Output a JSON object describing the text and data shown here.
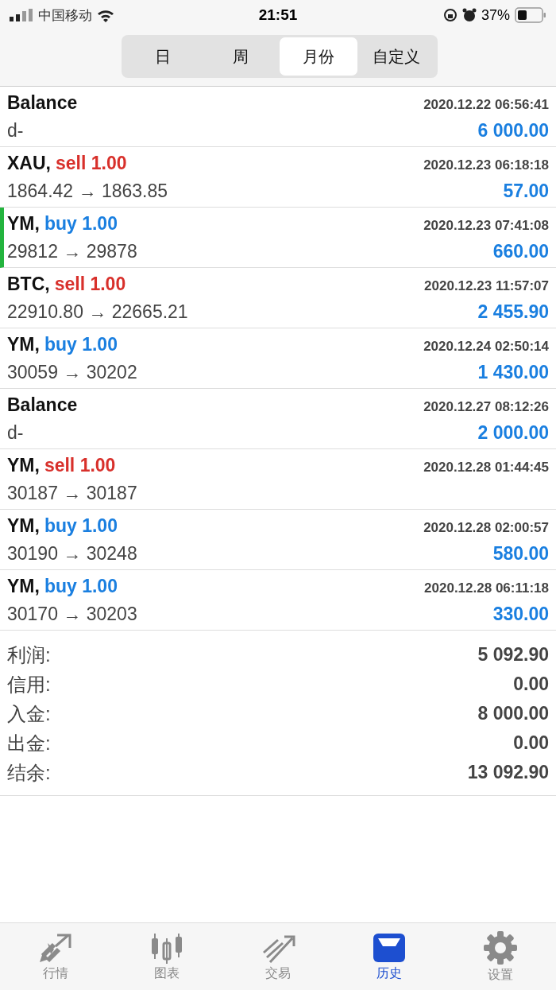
{
  "status_bar": {
    "carrier": "中国移动",
    "time": "21:51",
    "battery": "37%"
  },
  "periods": [
    {
      "label": "日",
      "selected": false
    },
    {
      "label": "周",
      "selected": false
    },
    {
      "label": "月份",
      "selected": true
    },
    {
      "label": "自定义",
      "selected": false
    }
  ],
  "deals": [
    {
      "kind": "balance",
      "title": "Balance",
      "time": "2020.12.22 06:56:41",
      "detail": "d-",
      "profit": "6 000.00",
      "marked": false
    },
    {
      "kind": "sell",
      "title": "XAU,",
      "volume": "sell 1.00",
      "time": "2020.12.23 06:18:18",
      "detail": "1864.42 → 1863.85",
      "profit": "57.00",
      "marked": false
    },
    {
      "kind": "buy",
      "title": "YM,",
      "volume": "buy 1.00",
      "time": "2020.12.23 07:41:08",
      "detail": "29812 → 29878",
      "profit": "660.00",
      "marked": true
    },
    {
      "kind": "sell",
      "title": "BTC,",
      "volume": "sell 1.00",
      "time": "2020.12.23 11:57:07",
      "detail": "22910.80 → 22665.21",
      "profit": "2 455.90",
      "marked": false
    },
    {
      "kind": "buy",
      "title": "YM,",
      "volume": "buy 1.00",
      "time": "2020.12.24 02:50:14",
      "detail": "30059 → 30202",
      "profit": "1 430.00",
      "marked": false
    },
    {
      "kind": "balance",
      "title": "Balance",
      "time": "2020.12.27 08:12:26",
      "detail": "d-",
      "profit": "2 000.00",
      "marked": false
    },
    {
      "kind": "sell",
      "title": "YM,",
      "volume": "sell 1.00",
      "time": "2020.12.28 01:44:45",
      "detail": "30187 → 30187",
      "marked": false
    },
    {
      "kind": "buy",
      "title": "YM,",
      "volume": "buy 1.00",
      "time": "2020.12.28 02:00:57",
      "detail": "30190 → 30248",
      "profit": "580.00",
      "marked": false
    },
    {
      "kind": "buy",
      "title": "YM,",
      "volume": "buy 1.00",
      "time": "2020.12.28 06:11:18",
      "detail": "30170 → 30203",
      "profit": "330.00",
      "marked": false
    }
  ],
  "summary": [
    {
      "label": "利润:",
      "value": "5 092.90"
    },
    {
      "label": "信用:",
      "value": "0.00"
    },
    {
      "label": "入金:",
      "value": "8 000.00"
    },
    {
      "label": "出金:",
      "value": "0.00"
    },
    {
      "label": "结余:",
      "value": "13 092.90"
    }
  ],
  "tab_bar": [
    {
      "label": "行情",
      "kind": "quotes",
      "selected": false
    },
    {
      "label": "图表",
      "kind": "chart",
      "selected": false
    },
    {
      "label": "交易",
      "kind": "trade",
      "selected": false
    },
    {
      "label": "历史",
      "kind": "history",
      "selected": true
    },
    {
      "label": "设置",
      "kind": "settings",
      "selected": false
    }
  ]
}
